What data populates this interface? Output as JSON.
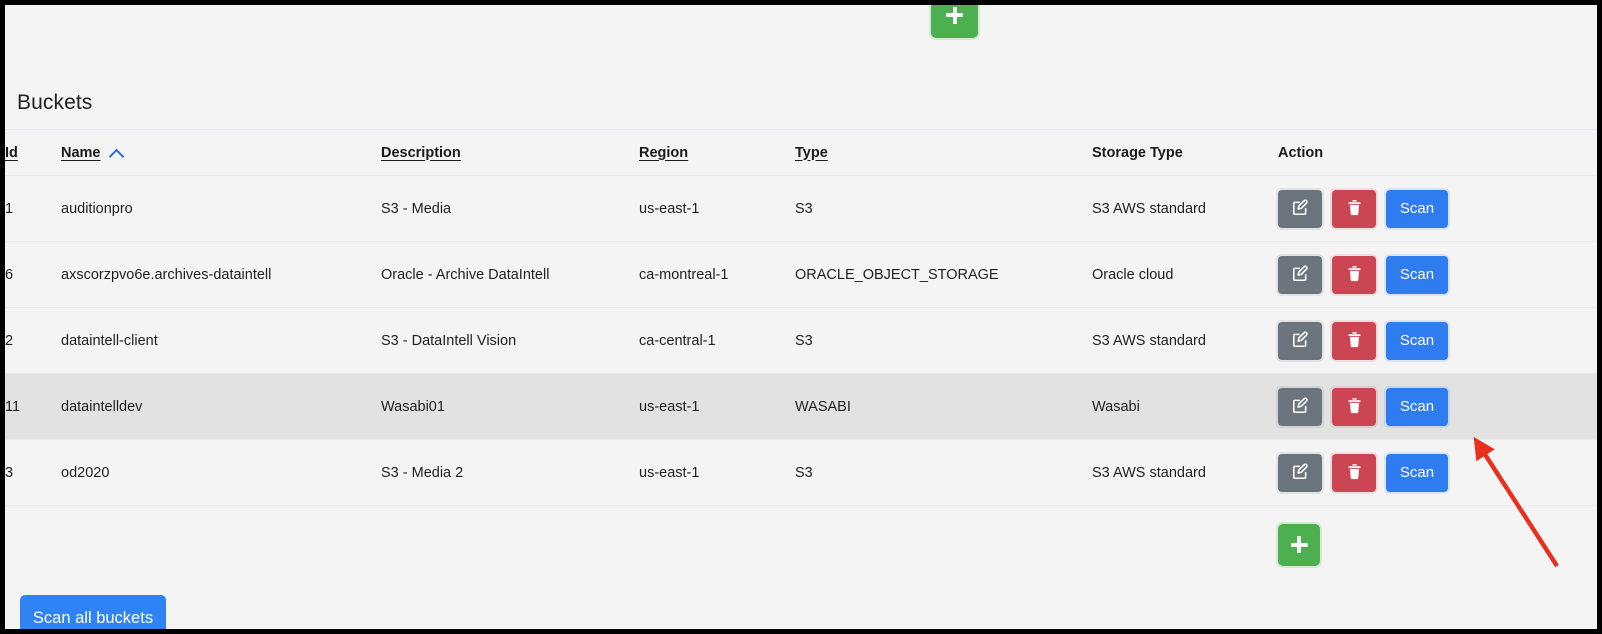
{
  "toolbar": {
    "add_bucket_top_label": "+",
    "add_bucket_top_icon": "plus-icon"
  },
  "panel": {
    "title": "Buckets"
  },
  "table": {
    "columns": [
      {
        "key": "id",
        "label": "Id",
        "sorted": false
      },
      {
        "key": "name",
        "label": "Name",
        "sorted": true,
        "sort_direction": "asc",
        "sort_icon": "chevron-up-icon"
      },
      {
        "key": "desc",
        "label": "Description",
        "sorted": false
      },
      {
        "key": "region",
        "label": "Region",
        "sorted": false
      },
      {
        "key": "type",
        "label": "Type",
        "sorted": false
      },
      {
        "key": "storage",
        "label": "Storage Type",
        "sorted": false
      },
      {
        "key": "action",
        "label": "Action",
        "sorted": false
      }
    ],
    "rows": [
      {
        "id": "1",
        "name": "auditionpro",
        "description": "S3 - Media",
        "region": "us-east-1",
        "type": "S3",
        "storage_type": "S3 AWS standard",
        "highlighted": false
      },
      {
        "id": "6",
        "name": "axscorzpvo6e.archives-dataintell",
        "description": "Oracle - Archive DataIntell",
        "region": "ca-montreal-1",
        "type": "ORACLE_OBJECT_STORAGE",
        "storage_type": "Oracle cloud",
        "highlighted": false
      },
      {
        "id": "2",
        "name": "dataintell-client",
        "description": "S3 - DataIntell Vision",
        "region": "ca-central-1",
        "type": "S3",
        "storage_type": "S3 AWS standard",
        "highlighted": false
      },
      {
        "id": "11",
        "name": "dataintelldev",
        "description": "Wasabi01",
        "region": "us-east-1",
        "type": "WASABI",
        "storage_type": "Wasabi",
        "highlighted": true
      },
      {
        "id": "3",
        "name": "od2020",
        "description": "S3 - Media 2",
        "region": "us-east-1",
        "type": "S3",
        "storage_type": "S3 AWS standard",
        "highlighted": false
      }
    ],
    "row_actions": {
      "edit_icon": "edit-pencil-icon",
      "delete_icon": "trash-icon",
      "scan_label": "Scan"
    },
    "add_bucket_bottom_label": "+",
    "add_bucket_bottom_icon": "plus-icon"
  },
  "footer": {
    "scan_all_label": "Scan all buckets"
  },
  "annotation": {
    "arrow_color": "#e8301c",
    "points_to": "scan-button-row-dataintelldev"
  },
  "colors": {
    "add_green": "#4caf50",
    "edit_gray": "#6c757d",
    "delete_red": "#cc4552",
    "scan_blue": "#2f7bf0",
    "footer_blue": "#3083f5",
    "row_highlight": "#e2e2e2",
    "surface": "#f4f4f4",
    "sort_chevron_blue": "#2b6fd4"
  }
}
